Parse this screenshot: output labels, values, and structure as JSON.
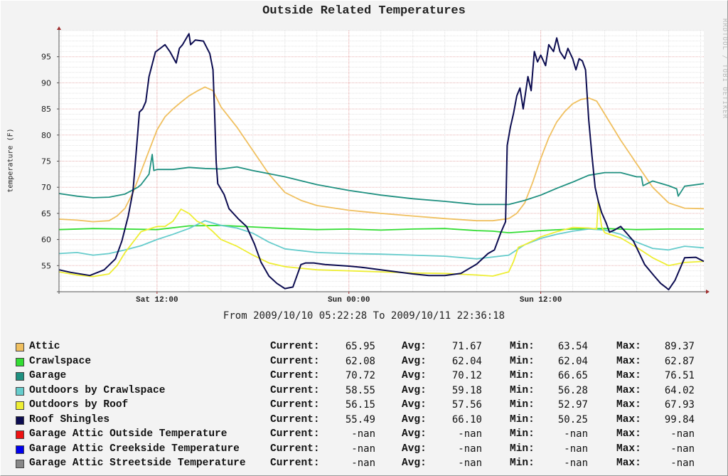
{
  "watermark": "RRDTOOL / TOBI OETIKER",
  "chart_data": {
    "type": "line",
    "title": "Outside Related Temperatures",
    "ylabel": "temperature (F)",
    "xlabel": "",
    "subtitle": "From 2009/10/10 05:22:28 To 2009/10/11 22:36:18",
    "x_units": "hours since Sat 2009/10/10 00:00",
    "xlim": [
      5.87,
      46.2
    ],
    "ylim": [
      50,
      100
    ],
    "yticks": [
      55,
      60,
      65,
      70,
      75,
      80,
      85,
      90,
      95
    ],
    "xticks": [
      {
        "x": 12,
        "label": "Sat 12:00"
      },
      {
        "x": 24,
        "label": "Sun 00:00"
      },
      {
        "x": 36,
        "label": "Sun 12:00"
      }
    ],
    "grid": true,
    "legend_position": "bottom",
    "series": [
      {
        "name": "Attic",
        "color": "#f0c060",
        "current": "65.95",
        "avg": "71.67",
        "min": "63.54",
        "max": "89.37",
        "x": [
          5.87,
          7,
          8,
          9,
          9.5,
          10,
          10.5,
          11,
          11.5,
          12,
          12.5,
          13,
          13.5,
          14,
          14.5,
          15,
          15.5,
          16,
          17,
          18,
          19,
          20,
          21,
          22,
          24,
          26,
          28,
          30,
          32,
          33,
          34,
          34.5,
          35,
          35.5,
          36,
          36.5,
          37,
          37.5,
          38,
          38.5,
          39,
          39.5,
          40,
          41,
          42,
          43,
          44,
          45,
          46.2
        ],
        "y": [
          63.9,
          63.7,
          63.4,
          63.6,
          64.5,
          66,
          69,
          73,
          77,
          81,
          83.5,
          85,
          86.3,
          87.5,
          88.4,
          89.2,
          88.5,
          85.4,
          81.5,
          77,
          72.5,
          69,
          67.5,
          66.5,
          65.6,
          65,
          64.5,
          64,
          63.6,
          63.6,
          64,
          65,
          67,
          71,
          75.5,
          79.5,
          82.5,
          84.5,
          86,
          86.8,
          87.1,
          86.5,
          84,
          79,
          74.5,
          70,
          67,
          66,
          65.9
        ]
      },
      {
        "name": "Crawlspace",
        "color": "#33dd33",
        "current": "62.08",
        "avg": "62.04",
        "min": "62.04",
        "max": "62.87",
        "x": [
          5.87,
          8,
          10,
          12,
          14,
          16,
          18,
          20,
          22,
          24,
          26,
          28,
          30,
          32,
          33,
          34,
          36,
          38,
          40,
          42,
          44,
          46.2
        ],
        "y": [
          61.9,
          62.1,
          62,
          61.9,
          62.6,
          62.7,
          62.4,
          62.1,
          61.9,
          62,
          61.8,
          62,
          62.1,
          61.7,
          61.6,
          61.3,
          61.7,
          62,
          62.1,
          61.9,
          62,
          62
        ]
      },
      {
        "name": "Garage",
        "color": "#1f9080",
        "current": "70.72",
        "avg": "70.12",
        "min": "66.65",
        "max": "76.51",
        "x": [
          5.87,
          7,
          8,
          9,
          10,
          10.8,
          11,
          11.5,
          11.7,
          11.8,
          12,
          13,
          14,
          15,
          16,
          17,
          18,
          20,
          22,
          24,
          26,
          28,
          30,
          32,
          34,
          35,
          36,
          37,
          38,
          39,
          40,
          41,
          42,
          42.3,
          42.4,
          43,
          44,
          44.5,
          44.6,
          45,
          46.2
        ],
        "y": [
          68.8,
          68.3,
          68,
          68.1,
          68.7,
          70,
          70.5,
          72.5,
          76.3,
          73.2,
          73.4,
          73.4,
          73.8,
          73.6,
          73.5,
          73.9,
          73.2,
          72,
          70.5,
          69.4,
          68.5,
          67.8,
          67.3,
          66.7,
          66.7,
          67.5,
          68.5,
          69.8,
          71,
          72.3,
          72.8,
          72.8,
          72,
          72,
          70.3,
          71.2,
          70.3,
          69.7,
          68.3,
          70.2,
          70.7
        ]
      },
      {
        "name": "Outdoors by Crawlspace",
        "color": "#66cccc",
        "current": "58.55",
        "avg": "59.18",
        "min": "56.28",
        "max": "64.02",
        "x": [
          5.87,
          7,
          8,
          9,
          10,
          11,
          12,
          13,
          14,
          15,
          16,
          17,
          18,
          19,
          20,
          22,
          24,
          26,
          28,
          30,
          32,
          34,
          35,
          36,
          37,
          38,
          39,
          40,
          41,
          42,
          43,
          44,
          45,
          46.2
        ],
        "y": [
          57.3,
          57.5,
          57,
          57.3,
          58,
          58.8,
          60,
          61,
          62.1,
          63.6,
          62.7,
          62.2,
          61.2,
          59.5,
          58.2,
          57.5,
          57.3,
          57.2,
          57,
          56.8,
          56.3,
          57,
          59,
          60.2,
          61,
          61.6,
          62,
          61.8,
          61,
          59.5,
          58.3,
          58,
          58.7,
          58.4
        ]
      },
      {
        "name": "Outdoors by Roof",
        "color": "#eeee33",
        "current": "56.15",
        "avg": "57.56",
        "min": "52.97",
        "max": "67.93",
        "x": [
          5.87,
          7,
          8,
          9,
          9.5,
          10,
          10.5,
          11,
          11.5,
          12,
          12.5,
          13,
          13.5,
          14,
          14.5,
          15,
          15.5,
          16,
          17,
          18,
          19,
          20,
          21,
          22,
          24,
          26,
          28,
          30,
          32,
          33,
          34,
          34.3,
          34.6,
          35,
          36,
          37,
          38,
          39,
          39.5,
          39.6,
          39.8,
          40,
          41,
          42,
          43,
          44,
          45,
          46.2
        ],
        "y": [
          53.8,
          53.2,
          52.9,
          53.4,
          55,
          57.5,
          59.5,
          61.5,
          62,
          62.5,
          62.5,
          63.5,
          65.8,
          65,
          63.5,
          62.8,
          61.5,
          60,
          58.7,
          57,
          55.5,
          54.8,
          54.5,
          54.2,
          54,
          53.8,
          53.6,
          53.5,
          53.2,
          53,
          53.8,
          55.8,
          58.5,
          59,
          60.5,
          61.5,
          62.3,
          62.2,
          62,
          67.5,
          62.5,
          61.3,
          60.3,
          58.5,
          56.5,
          55,
          55.6,
          55.8
        ]
      },
      {
        "name": "Roof Shingles",
        "color": "#0c0c50",
        "current": "55.49",
        "avg": "66.10",
        "min": "50.25",
        "max": "99.84",
        "x": [
          5.87,
          6.6,
          7.8,
          8.7,
          9.4,
          9.8,
          10.2,
          10.5,
          10.7,
          10.9,
          11.1,
          11.3,
          11.5,
          11.9,
          12.2,
          12.5,
          12.8,
          13.2,
          13.4,
          13.6,
          14,
          14.1,
          14.4,
          14.9,
          15.3,
          15.5,
          15.6,
          15.7,
          15.8,
          16.2,
          16.5,
          17.1,
          17.6,
          18.1,
          18.5,
          19,
          19.5,
          20,
          20.5,
          21,
          21.3,
          21.8,
          22.5,
          24,
          25,
          26,
          27,
          28,
          29,
          30,
          31,
          32,
          32.7,
          33.1,
          33.5,
          33.8,
          33.9,
          34.1,
          34.3,
          34.5,
          34.7,
          34.9,
          35.2,
          35.4,
          35.6,
          35.8,
          36,
          36.3,
          36.5,
          36.8,
          37,
          37.2,
          37.5,
          37.7,
          38,
          38.2,
          38.4,
          38.6,
          38.8,
          39,
          39.2,
          39.4,
          39.6,
          39.8,
          40.1,
          40.3,
          40.6,
          41,
          41.4,
          41.8,
          42.5,
          43.1,
          43.5,
          43.8,
          44,
          44.4,
          45,
          45.7,
          46.2
        ],
        "y": [
          54.2,
          53.7,
          53.1,
          54.2,
          56.3,
          59.7,
          64.5,
          69.3,
          76.8,
          84.4,
          85,
          86.4,
          91.2,
          95.9,
          96.6,
          97.3,
          96,
          93.8,
          96.6,
          97.3,
          99.4,
          97.3,
          98.2,
          98,
          95.6,
          92.5,
          84.4,
          74.8,
          70.7,
          68.6,
          65.9,
          63.9,
          62.5,
          59.1,
          55.7,
          53,
          51.6,
          50.6,
          50.9,
          55.2,
          55.5,
          55.5,
          55.2,
          54.9,
          54.6,
          54.2,
          53.8,
          53.4,
          53.1,
          53.1,
          53.5,
          55.3,
          57.3,
          58,
          61.3,
          63.4,
          78,
          81.5,
          84.2,
          87.5,
          89,
          85,
          91.2,
          88.5,
          96,
          94,
          95.3,
          93.3,
          97.3,
          96,
          98.6,
          96,
          94.6,
          96.6,
          94.6,
          92.5,
          94.6,
          94.2,
          92.5,
          82.9,
          76.1,
          70,
          67.3,
          65.2,
          63.1,
          61.4,
          61.8,
          62.5,
          61.1,
          59.7,
          55.2,
          53,
          51.6,
          50.9,
          50.4,
          52.2,
          56.5,
          56.6,
          55.8
        ]
      },
      {
        "name": "Garage Attic Outside Temperature",
        "color": "#ee1111",
        "current": "-nan",
        "avg": "-nan",
        "min": "-nan",
        "max": "-nan",
        "x": [],
        "y": []
      },
      {
        "name": "Garage Attic Creekside Temperature",
        "color": "#0000ee",
        "current": "-nan",
        "avg": "-nan",
        "min": "-nan",
        "max": "-nan",
        "x": [],
        "y": []
      },
      {
        "name": "Garage Attic Streetside Temperature",
        "color": "#888888",
        "current": "-nan",
        "avg": "-nan",
        "min": "-nan",
        "max": "-nan",
        "x": [],
        "y": []
      }
    ]
  },
  "legend_labels": {
    "current": "Current:",
    "avg": "Avg:",
    "min": "Min:",
    "max": "Max:"
  }
}
